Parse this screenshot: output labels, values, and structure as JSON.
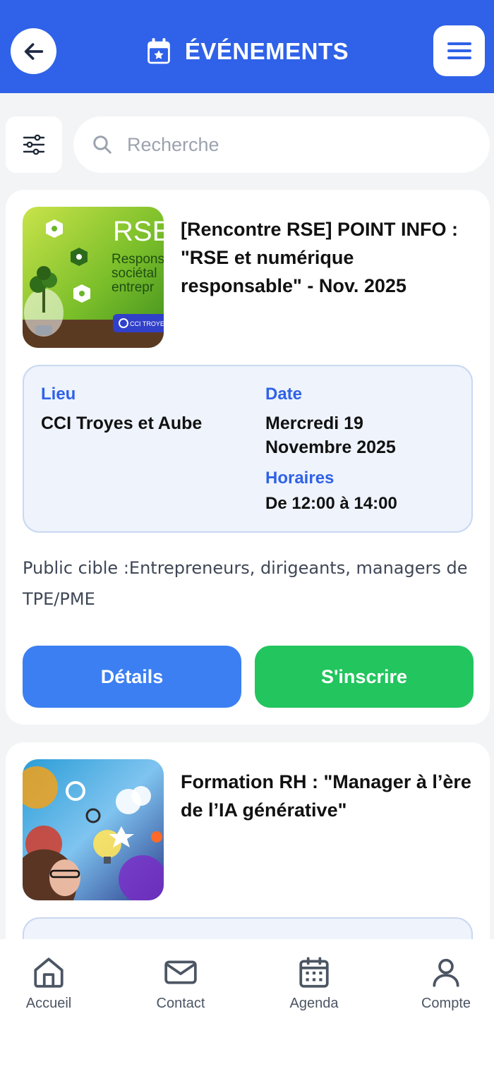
{
  "header": {
    "title": "ÉVÉNEMENTS",
    "back_icon": "arrow-left-icon",
    "menu_icon": "hamburger-icon",
    "title_icon": "calendar-star-icon",
    "bg_color": "#2f62e8"
  },
  "search": {
    "placeholder": "Recherche",
    "value": "",
    "filter_icon": "sliders-icon"
  },
  "events": [
    {
      "title": "[Rencontre RSE] POINT INFO : \"RSE et numérique responsable\" - Nov. 2025",
      "image_text": {
        "headline": "RSE",
        "line1": "Respons",
        "line2": "sociétal",
        "line3": "entrepr",
        "badge": "CCI TROYE"
      },
      "lieu_label": "Lieu",
      "lieu": "CCI Troyes et Aube",
      "date_label": "Date",
      "date": "Mercredi 19 Novembre 2025",
      "horaires_label": "Horaires",
      "horaires": "De 12:00 à 14:00",
      "audience": "Public cible :Entrepreneurs, dirigeants, managers de TPE/PME",
      "details_label": "Détails",
      "register_label": "S'inscrire"
    },
    {
      "title": "Formation RH : \"Manager à l’ère de l’IA générative\""
    }
  ],
  "bottom_nav": {
    "items": [
      {
        "label": "Accueil",
        "icon": "home-icon"
      },
      {
        "label": "Contact",
        "icon": "mail-icon"
      },
      {
        "label": "Agenda",
        "icon": "calendar-icon"
      },
      {
        "label": "Compte",
        "icon": "user-icon"
      }
    ]
  },
  "colors": {
    "accent": "#2f62e8",
    "details_button": "#3b7ff2",
    "register_button": "#22c55e"
  }
}
